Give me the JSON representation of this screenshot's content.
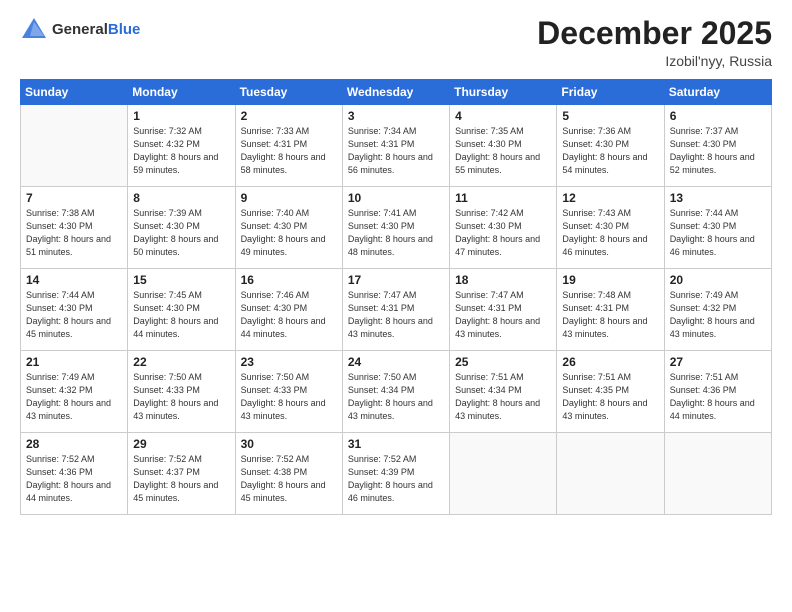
{
  "header": {
    "logo_general": "General",
    "logo_blue": "Blue",
    "month_title": "December 2025",
    "location": "Izobil'nyy, Russia"
  },
  "weekdays": [
    "Sunday",
    "Monday",
    "Tuesday",
    "Wednesday",
    "Thursday",
    "Friday",
    "Saturday"
  ],
  "weeks": [
    [
      {
        "day": "",
        "sunrise": "",
        "sunset": "",
        "daylight": ""
      },
      {
        "day": "1",
        "sunrise": "Sunrise: 7:32 AM",
        "sunset": "Sunset: 4:32 PM",
        "daylight": "Daylight: 8 hours and 59 minutes."
      },
      {
        "day": "2",
        "sunrise": "Sunrise: 7:33 AM",
        "sunset": "Sunset: 4:31 PM",
        "daylight": "Daylight: 8 hours and 58 minutes."
      },
      {
        "day": "3",
        "sunrise": "Sunrise: 7:34 AM",
        "sunset": "Sunset: 4:31 PM",
        "daylight": "Daylight: 8 hours and 56 minutes."
      },
      {
        "day": "4",
        "sunrise": "Sunrise: 7:35 AM",
        "sunset": "Sunset: 4:30 PM",
        "daylight": "Daylight: 8 hours and 55 minutes."
      },
      {
        "day": "5",
        "sunrise": "Sunrise: 7:36 AM",
        "sunset": "Sunset: 4:30 PM",
        "daylight": "Daylight: 8 hours and 54 minutes."
      },
      {
        "day": "6",
        "sunrise": "Sunrise: 7:37 AM",
        "sunset": "Sunset: 4:30 PM",
        "daylight": "Daylight: 8 hours and 52 minutes."
      }
    ],
    [
      {
        "day": "7",
        "sunrise": "Sunrise: 7:38 AM",
        "sunset": "Sunset: 4:30 PM",
        "daylight": "Daylight: 8 hours and 51 minutes."
      },
      {
        "day": "8",
        "sunrise": "Sunrise: 7:39 AM",
        "sunset": "Sunset: 4:30 PM",
        "daylight": "Daylight: 8 hours and 50 minutes."
      },
      {
        "day": "9",
        "sunrise": "Sunrise: 7:40 AM",
        "sunset": "Sunset: 4:30 PM",
        "daylight": "Daylight: 8 hours and 49 minutes."
      },
      {
        "day": "10",
        "sunrise": "Sunrise: 7:41 AM",
        "sunset": "Sunset: 4:30 PM",
        "daylight": "Daylight: 8 hours and 48 minutes."
      },
      {
        "day": "11",
        "sunrise": "Sunrise: 7:42 AM",
        "sunset": "Sunset: 4:30 PM",
        "daylight": "Daylight: 8 hours and 47 minutes."
      },
      {
        "day": "12",
        "sunrise": "Sunrise: 7:43 AM",
        "sunset": "Sunset: 4:30 PM",
        "daylight": "Daylight: 8 hours and 46 minutes."
      },
      {
        "day": "13",
        "sunrise": "Sunrise: 7:44 AM",
        "sunset": "Sunset: 4:30 PM",
        "daylight": "Daylight: 8 hours and 46 minutes."
      }
    ],
    [
      {
        "day": "14",
        "sunrise": "Sunrise: 7:44 AM",
        "sunset": "Sunset: 4:30 PM",
        "daylight": "Daylight: 8 hours and 45 minutes."
      },
      {
        "day": "15",
        "sunrise": "Sunrise: 7:45 AM",
        "sunset": "Sunset: 4:30 PM",
        "daylight": "Daylight: 8 hours and 44 minutes."
      },
      {
        "day": "16",
        "sunrise": "Sunrise: 7:46 AM",
        "sunset": "Sunset: 4:30 PM",
        "daylight": "Daylight: 8 hours and 44 minutes."
      },
      {
        "day": "17",
        "sunrise": "Sunrise: 7:47 AM",
        "sunset": "Sunset: 4:31 PM",
        "daylight": "Daylight: 8 hours and 43 minutes."
      },
      {
        "day": "18",
        "sunrise": "Sunrise: 7:47 AM",
        "sunset": "Sunset: 4:31 PM",
        "daylight": "Daylight: 8 hours and 43 minutes."
      },
      {
        "day": "19",
        "sunrise": "Sunrise: 7:48 AM",
        "sunset": "Sunset: 4:31 PM",
        "daylight": "Daylight: 8 hours and 43 minutes."
      },
      {
        "day": "20",
        "sunrise": "Sunrise: 7:49 AM",
        "sunset": "Sunset: 4:32 PM",
        "daylight": "Daylight: 8 hours and 43 minutes."
      }
    ],
    [
      {
        "day": "21",
        "sunrise": "Sunrise: 7:49 AM",
        "sunset": "Sunset: 4:32 PM",
        "daylight": "Daylight: 8 hours and 43 minutes."
      },
      {
        "day": "22",
        "sunrise": "Sunrise: 7:50 AM",
        "sunset": "Sunset: 4:33 PM",
        "daylight": "Daylight: 8 hours and 43 minutes."
      },
      {
        "day": "23",
        "sunrise": "Sunrise: 7:50 AM",
        "sunset": "Sunset: 4:33 PM",
        "daylight": "Daylight: 8 hours and 43 minutes."
      },
      {
        "day": "24",
        "sunrise": "Sunrise: 7:50 AM",
        "sunset": "Sunset: 4:34 PM",
        "daylight": "Daylight: 8 hours and 43 minutes."
      },
      {
        "day": "25",
        "sunrise": "Sunrise: 7:51 AM",
        "sunset": "Sunset: 4:34 PM",
        "daylight": "Daylight: 8 hours and 43 minutes."
      },
      {
        "day": "26",
        "sunrise": "Sunrise: 7:51 AM",
        "sunset": "Sunset: 4:35 PM",
        "daylight": "Daylight: 8 hours and 43 minutes."
      },
      {
        "day": "27",
        "sunrise": "Sunrise: 7:51 AM",
        "sunset": "Sunset: 4:36 PM",
        "daylight": "Daylight: 8 hours and 44 minutes."
      }
    ],
    [
      {
        "day": "28",
        "sunrise": "Sunrise: 7:52 AM",
        "sunset": "Sunset: 4:36 PM",
        "daylight": "Daylight: 8 hours and 44 minutes."
      },
      {
        "day": "29",
        "sunrise": "Sunrise: 7:52 AM",
        "sunset": "Sunset: 4:37 PM",
        "daylight": "Daylight: 8 hours and 45 minutes."
      },
      {
        "day": "30",
        "sunrise": "Sunrise: 7:52 AM",
        "sunset": "Sunset: 4:38 PM",
        "daylight": "Daylight: 8 hours and 45 minutes."
      },
      {
        "day": "31",
        "sunrise": "Sunrise: 7:52 AM",
        "sunset": "Sunset: 4:39 PM",
        "daylight": "Daylight: 8 hours and 46 minutes."
      },
      {
        "day": "",
        "sunrise": "",
        "sunset": "",
        "daylight": ""
      },
      {
        "day": "",
        "sunrise": "",
        "sunset": "",
        "daylight": ""
      },
      {
        "day": "",
        "sunrise": "",
        "sunset": "",
        "daylight": ""
      }
    ]
  ]
}
